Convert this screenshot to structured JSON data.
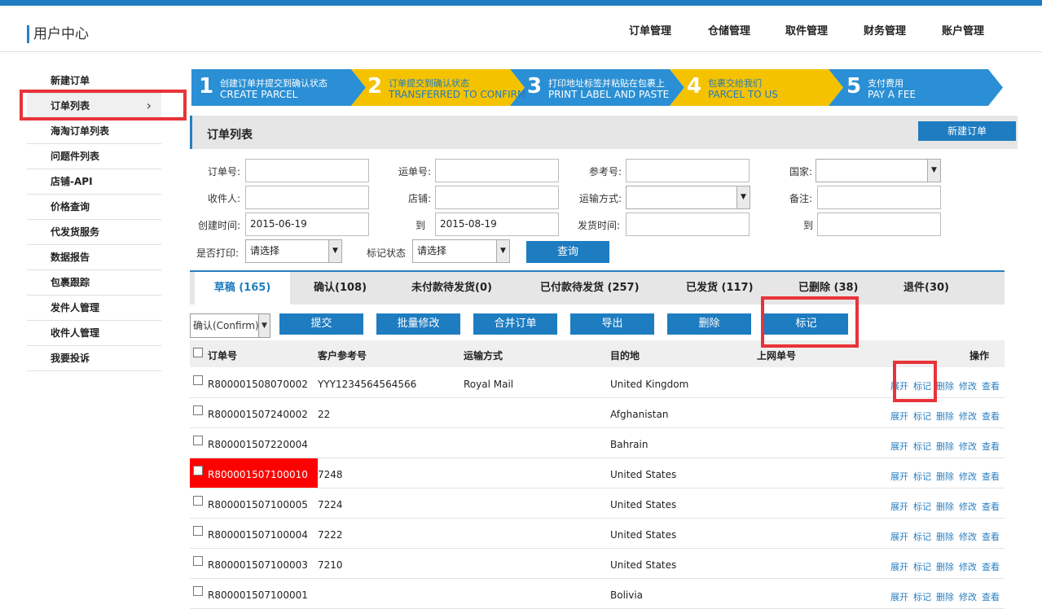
{
  "app": {
    "title": "用户中心"
  },
  "nav": [
    "订单管理",
    "仓储管理",
    "取件管理",
    "财务管理",
    "账户管理"
  ],
  "sidebar": {
    "items": [
      {
        "label": "新建订单"
      },
      {
        "label": "订单列表",
        "active": true
      },
      {
        "label": "海淘订单列表"
      },
      {
        "label": "问题件列表"
      },
      {
        "label": "店铺-API"
      },
      {
        "label": "价格查询"
      },
      {
        "label": "代发货服务"
      },
      {
        "label": "数据报告"
      },
      {
        "label": "包裹跟踪"
      },
      {
        "label": "发件人管理"
      },
      {
        "label": "收件人管理"
      },
      {
        "label": "我要投诉"
      }
    ],
    "chevron": "›"
  },
  "steps": [
    {
      "num": "1",
      "cn": "创建订单并提交到确认状态",
      "en": "CREATE  PARCEL",
      "color": "#2a8fd4",
      "text_color": "#ffffff"
    },
    {
      "num": "2",
      "cn": "订单提交到确认状态",
      "en": "TRANSFERRED TO CONFIRM",
      "color": "#f5c200",
      "text_color": "#1e7cc0"
    },
    {
      "num": "3",
      "cn": "打印地址标签并粘贴在包裹上",
      "en": "PRINT LABEL AND PASTE",
      "color": "#2a8fd4",
      "text_color": "#ffffff"
    },
    {
      "num": "4",
      "cn": "包裹交给我们",
      "en": "PARCEL TO US",
      "color": "#f5c200",
      "text_color": "#1e7cc0"
    },
    {
      "num": "5",
      "cn": "支付费用",
      "en": "PAY A FEE",
      "color": "#2a8fd4",
      "text_color": "#ffffff"
    }
  ],
  "section": {
    "title": "订单列表",
    "new_button": "新建订单"
  },
  "filters": {
    "order_no": {
      "label": "订单号:",
      "value": ""
    },
    "waybill_no": {
      "label": "运单号:",
      "value": ""
    },
    "ref_no": {
      "label": "参考号:",
      "value": ""
    },
    "country": {
      "label": "国家:",
      "value": ""
    },
    "receiver": {
      "label": "收件人:",
      "value": ""
    },
    "shop": {
      "label": "店铺:",
      "value": ""
    },
    "shipping": {
      "label": "运输方式:",
      "value": ""
    },
    "remark": {
      "label": "备注:",
      "value": ""
    },
    "created": {
      "label": "创建时间:",
      "value": "2015-06-19"
    },
    "created_to": {
      "label": "到",
      "value": "2015-08-19"
    },
    "ship_time": {
      "label": "发货时间:",
      "value": ""
    },
    "ship_to": {
      "label": "到",
      "value": ""
    },
    "printed": {
      "label": "是否打印:",
      "value": "请选择"
    },
    "mark_status": {
      "label": "标记状态",
      "value": "请选择"
    },
    "query_button": "查询"
  },
  "tabs": [
    "草稿 (165)",
    "确认(108)",
    "未付款待发货(0)",
    "已付款待发货 (257)",
    "已发货 (117)",
    "已删除 (38)",
    "退件(30)"
  ],
  "actions": {
    "status_select": "确认(Confirm)",
    "buttons": [
      "提交",
      "批量修改",
      "合并订单",
      "导出",
      "删除",
      "标记"
    ]
  },
  "table": {
    "headers": [
      "订单号",
      "客户参考号",
      "运输方式",
      "目的地",
      "上网单号",
      "操作"
    ],
    "ops": [
      "展开",
      "标记",
      "删除",
      "修改",
      "查看"
    ],
    "rows": [
      {
        "id": "R800001508070002",
        "ref": "YYY1234564564566",
        "ship": "Royal Mail",
        "dest": "United Kingdom"
      },
      {
        "id": "R800001507240002",
        "ref": "22",
        "ship": "",
        "dest": "Afghanistan"
      },
      {
        "id": "R800001507220004",
        "ref": "",
        "ship": "",
        "dest": "Bahrain"
      },
      {
        "id": "R800001507100010",
        "ref": "7248",
        "ship": "",
        "dest": "United States",
        "highlight": true
      },
      {
        "id": "R800001507100005",
        "ref": "7224",
        "ship": "",
        "dest": "United States"
      },
      {
        "id": "R800001507100004",
        "ref": "7222",
        "ship": "",
        "dest": "United States"
      },
      {
        "id": "R800001507100003",
        "ref": "7210",
        "ship": "",
        "dest": "United States"
      },
      {
        "id": "R800001507100001",
        "ref": "",
        "ship": "",
        "dest": "Bolivia"
      }
    ]
  },
  "colors": {
    "accent": "#1e7cc0",
    "highlight": "#ff0000",
    "annotation": "#e8333a",
    "step_yellow": "#f5c200"
  }
}
